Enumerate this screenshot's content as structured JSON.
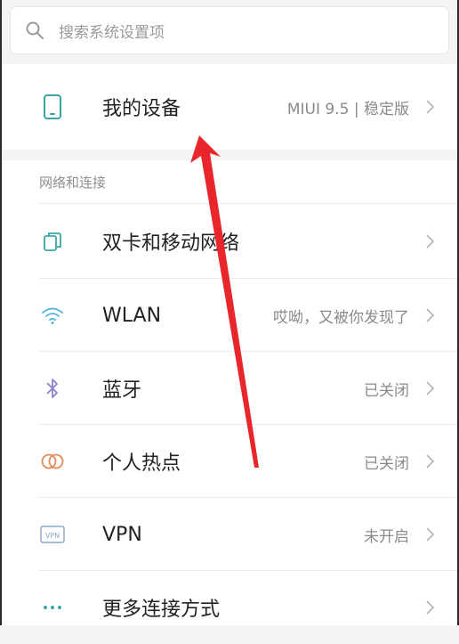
{
  "search": {
    "placeholder": "搜索系统设置项"
  },
  "device": {
    "label": "我的设备",
    "value": "MIUI 9.5 | 稳定版",
    "icon": "phone-icon"
  },
  "section": {
    "title": "网络和连接"
  },
  "items": [
    {
      "label": "双卡和移动网络",
      "value": "",
      "icon": "dual-sim-icon"
    },
    {
      "label": "WLAN",
      "value": "哎呦，又被你发现了",
      "icon": "wifi-icon"
    },
    {
      "label": "蓝牙",
      "value": "已关闭",
      "icon": "bluetooth-icon"
    },
    {
      "label": "个人热点",
      "value": "已关闭",
      "icon": "hotspot-icon"
    },
    {
      "label": "VPN",
      "value": "未开启",
      "icon": "vpn-icon"
    },
    {
      "label": "更多连接方式",
      "value": "",
      "icon": "more-dots-icon"
    }
  ],
  "vpn_badge_text": "VPN",
  "colors": {
    "accent_teal": "#3aa6a6",
    "wifi_blue": "#4fb3d9",
    "bluetooth_purple": "#8f7fd0",
    "hotspot_orange": "#e58b5a",
    "annotation_red": "#e8262b"
  }
}
